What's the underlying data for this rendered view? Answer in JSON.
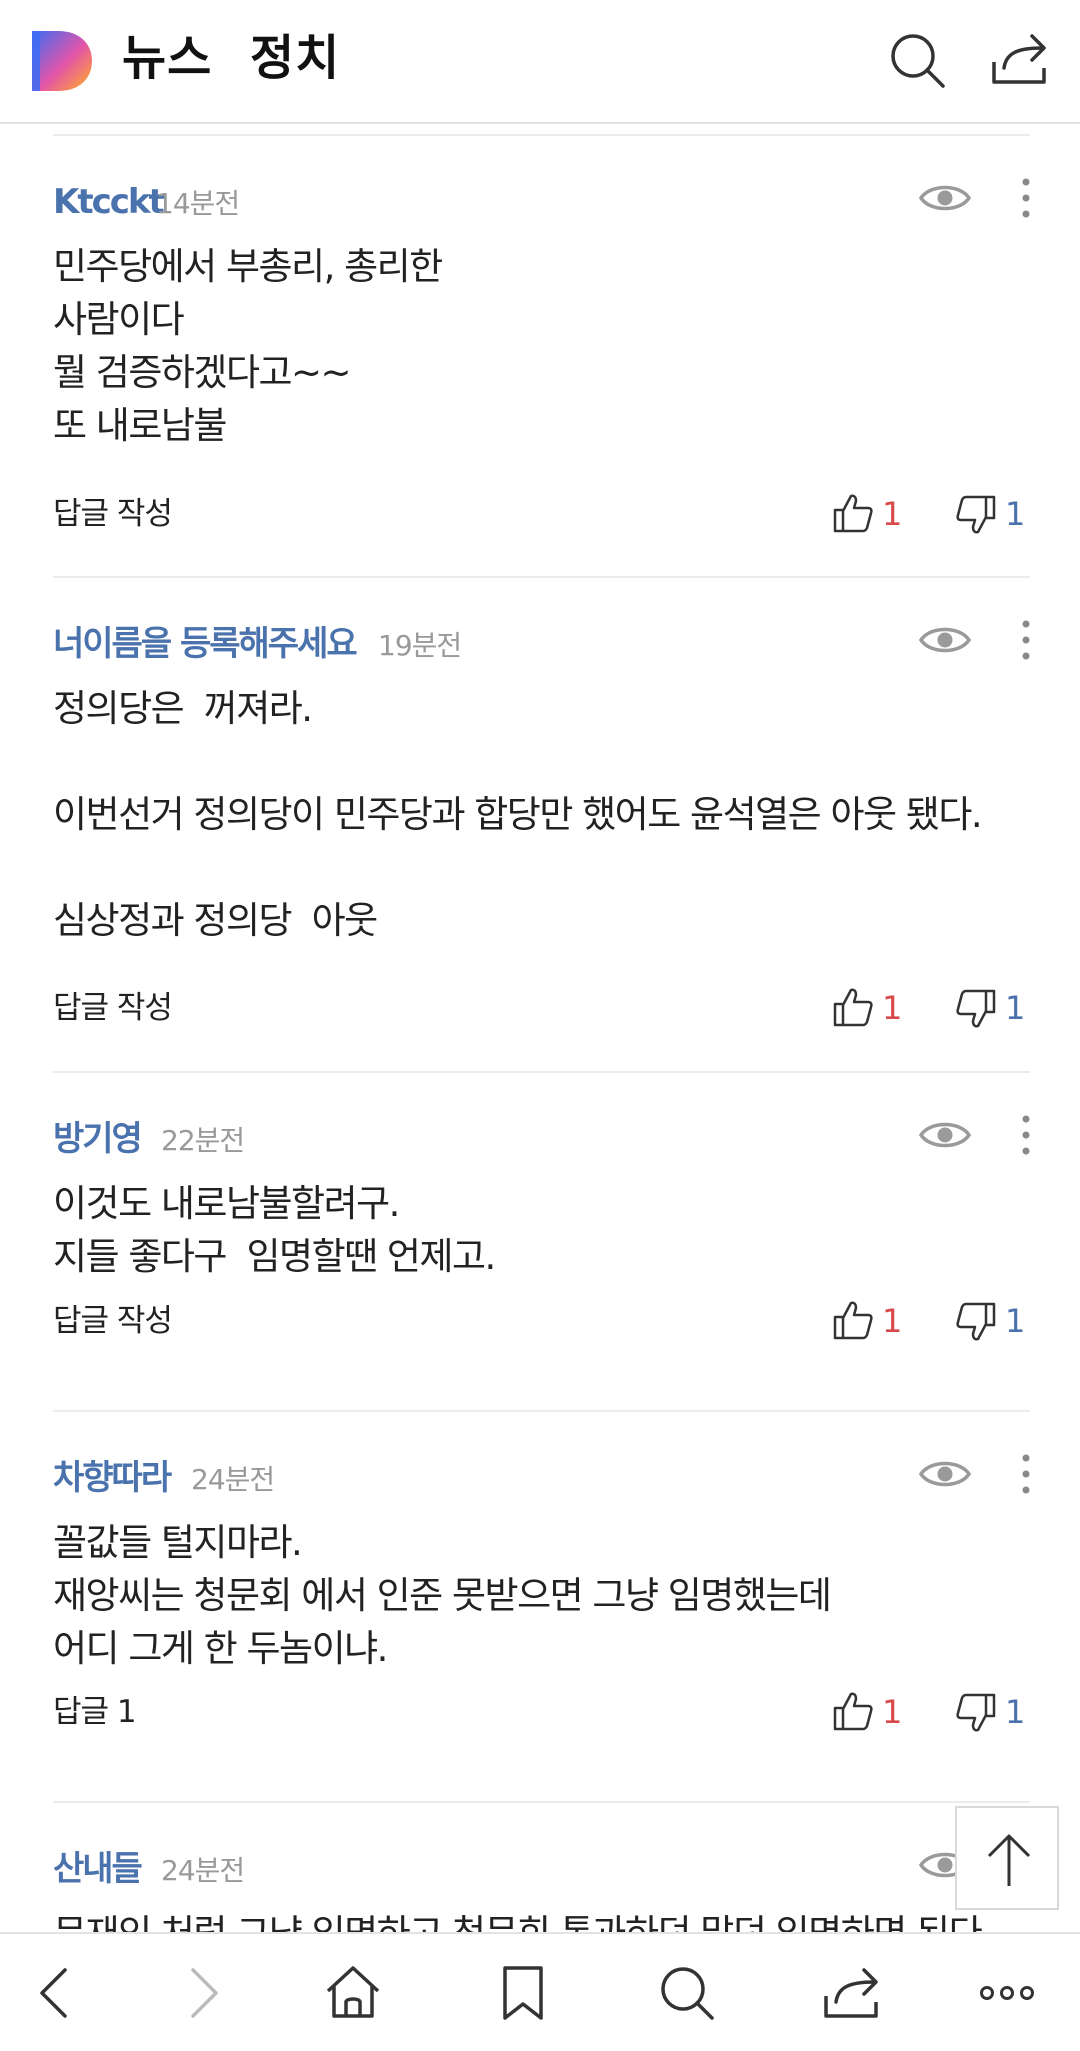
{
  "header": {
    "news_label": "뉴스",
    "section_label": "정치"
  },
  "comments": [
    {
      "author": "Ktcckt",
      "time": "14분전",
      "body": "민주당에서 부총리, 총리한\n사람이다\n뭘 검증하겠다고~~\n또 내로남불",
      "reply": "답글 작성",
      "likes": "1",
      "dislikes": "1"
    },
    {
      "author": "너이름을 등록해주세요",
      "time": "19분전",
      "body": "정의당은  꺼져라.\n\n이번선거 정의당이 민주당과 합당만 했어도 윤석열은 아웃 됐다.\n\n심상정과 정의당  아웃",
      "reply": "답글 작성",
      "likes": "1",
      "dislikes": "1"
    },
    {
      "author": "방기영",
      "time": "22분전",
      "body": "이것도 내로남불할려구.\n지들 좋다구  임명할땐 언제고.",
      "reply": "답글 작성",
      "likes": "1",
      "dislikes": "1"
    },
    {
      "author": "차향따라",
      "time": "24분전",
      "body": "꼴값들 털지마라.\n재앙씨는 청문회 에서 인준 못받으면 그냥 임명했는데\n어디 그게 한 두놈이냐.",
      "reply": "답글 1",
      "likes": "1",
      "dislikes": "1"
    },
    {
      "author": "산내들",
      "time": "24분전",
      "body": "문재인 처럼 그냥 임명하고 청문회 통과하던 말던 임명하면 된다",
      "reply": "",
      "likes": "",
      "dislikes": ""
    }
  ],
  "colors": {
    "author": "#4a72ad",
    "like": "#d84a4a",
    "dislike": "#4a72ad",
    "logo_gradient": [
      "#3b6df5",
      "#e455a8",
      "#ffb21e"
    ]
  },
  "icons": {
    "header": [
      "daum-logo",
      "search-icon",
      "share-icon"
    ],
    "comment": [
      "eye-icon",
      "more-vertical-icon",
      "thumbs-up-icon",
      "thumbs-down-icon"
    ],
    "bottom": [
      "back-icon",
      "forward-icon",
      "home-icon",
      "bookmark-icon",
      "search-icon",
      "share-icon",
      "more-horizontal-icon"
    ]
  }
}
